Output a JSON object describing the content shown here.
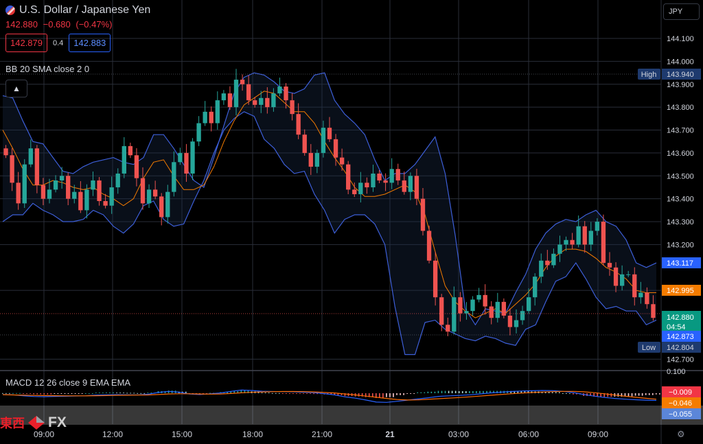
{
  "header": {
    "symbol_title": "U.S. Dollar / Japanese Yen",
    "last_price": "142.880",
    "change": "−0.680",
    "change_pct": "(−0.47%)",
    "bid": "142.879",
    "spread": "0.4",
    "ask": "142.883",
    "currency_button": "JPY"
  },
  "indicators": {
    "bb_label": "BB 20 SMA close 2 0",
    "macd_label": "MACD 12 26 close 9 EMA EMA"
  },
  "watermark": {
    "cn": "東西",
    "fx": "FX"
  },
  "colors": {
    "up": "#26a69a",
    "down": "#ef5350",
    "bb_band": "#3d5fd9",
    "bb_basis": "#f57c00",
    "macd_line": "#2962ff",
    "signal_line": "#ff6d00",
    "grid": "#2a2e39"
  },
  "icons": {
    "collapse": "chevron-up-icon",
    "settings": "gear-icon",
    "flag": "us-flag-icon"
  },
  "chart_data": [
    {
      "type": "line",
      "series_kind": "candlestick",
      "ylim": [
        142.68,
        144.15
      ],
      "y_ticks": [
        "144.100",
        "144.000",
        "143.900",
        "143.800",
        "143.700",
        "143.600",
        "143.500",
        "143.400",
        "143.300",
        "143.200",
        "143.000",
        "142.700"
      ],
      "x_ticks": [
        "09:00",
        "12:00",
        "15:00",
        "18:00",
        "21:00",
        "21",
        "03:00",
        "06:00",
        "09:00"
      ],
      "price_labels": [
        {
          "tag": "High",
          "value": "143.940",
          "kind": "high"
        },
        {
          "value": "143.117",
          "kind": "bb-upper"
        },
        {
          "value": "142.995",
          "kind": "bb-basis"
        },
        {
          "value": "142.880",
          "sub": "04:54",
          "kind": "last"
        },
        {
          "value": "142.873",
          "kind": "bb-lower"
        },
        {
          "tag": "Low",
          "value": "142.804",
          "kind": "low"
        }
      ],
      "close": [
        143.59,
        143.47,
        143.38,
        143.55,
        143.62,
        143.46,
        143.4,
        143.44,
        143.48,
        143.5,
        143.4,
        143.43,
        143.35,
        143.44,
        143.48,
        143.39,
        143.37,
        143.45,
        143.51,
        143.63,
        143.59,
        143.49,
        143.38,
        143.44,
        143.41,
        143.32,
        143.43,
        143.56,
        143.6,
        143.51,
        143.65,
        143.73,
        143.78,
        143.73,
        143.83,
        143.86,
        143.8,
        143.92,
        143.9,
        143.83,
        143.81,
        143.84,
        143.8,
        143.86,
        143.89,
        143.83,
        143.77,
        143.68,
        143.6,
        143.54,
        143.6,
        143.71,
        143.66,
        143.58,
        143.55,
        143.44,
        143.42,
        143.47,
        143.45,
        143.51,
        143.48,
        143.47,
        143.53,
        143.48,
        143.43,
        143.5,
        143.4,
        143.26,
        143.13,
        142.97,
        142.85,
        142.82,
        142.97,
        142.9,
        142.91,
        142.96,
        142.98,
        142.93,
        142.88,
        142.95,
        142.89,
        142.84,
        142.87,
        142.91,
        142.97,
        143.06,
        143.13,
        143.11,
        143.16,
        143.2,
        143.22,
        143.2,
        143.28,
        143.2,
        143.26,
        143.3,
        143.12,
        143.1,
        143.02,
        143.07,
        143.07,
        142.97,
        142.99,
        142.94,
        142.88
      ],
      "bb_upper": [
        143.85,
        143.84,
        143.74,
        143.65,
        143.64,
        143.58,
        143.52,
        143.51,
        143.54,
        143.56,
        143.57,
        143.58,
        143.56,
        143.55,
        143.58,
        143.68,
        143.68,
        143.62,
        143.55,
        143.48,
        143.45,
        143.58,
        143.72,
        143.86,
        143.93,
        143.95,
        143.94,
        143.91,
        143.87,
        143.86,
        143.88,
        143.94,
        143.95,
        143.83,
        143.77,
        143.73,
        143.68,
        143.57,
        143.48,
        143.51,
        143.51,
        143.55,
        143.61,
        143.67,
        143.51,
        143.24,
        142.92,
        142.85,
        142.92,
        142.91,
        142.9,
        142.99,
        143.07,
        143.18,
        143.25,
        143.29,
        143.31,
        143.3,
        143.33,
        143.35,
        143.3,
        143.28,
        143.22,
        143.12,
        143.1,
        143.12
      ],
      "bb_basis": [
        143.7,
        143.62,
        143.53,
        143.46,
        143.46,
        143.48,
        143.47,
        143.45,
        143.44,
        143.45,
        143.42,
        143.4,
        143.37,
        143.4,
        143.49,
        143.56,
        143.57,
        143.5,
        143.44,
        143.44,
        143.46,
        143.54,
        143.65,
        143.74,
        143.81,
        143.84,
        143.87,
        143.86,
        143.82,
        143.78,
        143.78,
        143.73,
        143.65,
        143.58,
        143.52,
        143.45,
        143.41,
        143.41,
        143.42,
        143.44,
        143.46,
        143.43,
        143.33,
        143.17,
        143.02,
        142.95,
        142.91,
        142.88,
        142.9,
        142.92,
        142.9,
        142.94,
        142.98,
        143.03,
        143.1,
        143.15,
        143.18,
        143.18,
        143.17,
        143.14,
        143.1,
        143.08,
        143.05,
        143.0,
        142.99,
        142.99
      ],
      "bb_lower": [
        143.3,
        143.33,
        143.33,
        143.38,
        143.35,
        143.33,
        143.3,
        143.3,
        143.31,
        143.35,
        143.33,
        143.28,
        143.25,
        143.29,
        143.37,
        143.39,
        143.31,
        143.28,
        143.29,
        143.39,
        143.48,
        143.6,
        143.7,
        143.75,
        143.78,
        143.76,
        143.66,
        143.62,
        143.55,
        143.51,
        143.52,
        143.42,
        143.35,
        143.25,
        143.31,
        143.33,
        143.33,
        143.29,
        143.2,
        142.93,
        142.72,
        142.72,
        142.86,
        142.87,
        142.83,
        142.81,
        142.79,
        142.78,
        142.8,
        142.79,
        142.77,
        142.76,
        142.83,
        142.85,
        142.95,
        143.04,
        143.06,
        143.12,
        143.05,
        142.97,
        142.92,
        142.93,
        142.91,
        142.91,
        142.85,
        142.87
      ],
      "title": "U.S. Dollar / Japanese Yen"
    },
    {
      "type": "line",
      "subtype": "macd",
      "ylim": [
        -0.1,
        0.1
      ],
      "y_ticks": [
        "0.100"
      ],
      "value_labels": [
        {
          "value": "−0.009",
          "kind": "histogram"
        },
        {
          "value": "−0.046",
          "kind": "signal"
        },
        {
          "value": "−0.055",
          "kind": "macd"
        }
      ],
      "macd": [
        -0.01,
        -0.012,
        -0.02,
        -0.025,
        -0.027,
        -0.024,
        -0.023,
        -0.021,
        -0.02,
        -0.014,
        -0.012,
        -0.011,
        -0.012,
        -0.013,
        -0.008,
        0.006,
        0.014,
        0.008,
        -0.006,
        -0.01,
        -0.004,
        0.002,
        0.014,
        0.024,
        0.021,
        0.015,
        0.013,
        0.012,
        0.011,
        0.008,
        0.004,
        -0.003,
        -0.013,
        -0.028,
        -0.038,
        -0.052,
        -0.068,
        -0.07,
        -0.062,
        -0.053,
        -0.044,
        -0.035,
        -0.024,
        -0.02,
        -0.017,
        -0.012,
        -0.005,
        0.002,
        0.008,
        0.013,
        0.017,
        0.019,
        0.021,
        0.02,
        0.014,
        0.005,
        -0.01,
        -0.022,
        -0.032,
        -0.04,
        -0.046,
        -0.05,
        -0.053,
        -0.055
      ],
      "signal": [
        -0.011,
        -0.013,
        -0.015,
        -0.017,
        -0.018,
        -0.019,
        -0.02,
        -0.02,
        -0.02,
        -0.019,
        -0.018,
        -0.016,
        -0.015,
        -0.014,
        -0.013,
        -0.01,
        -0.006,
        -0.004,
        -0.004,
        -0.006,
        -0.007,
        -0.006,
        -0.002,
        0.003,
        0.007,
        0.01,
        0.012,
        0.013,
        0.013,
        0.012,
        0.01,
        0.006,
        0.002,
        -0.006,
        -0.013,
        -0.022,
        -0.031,
        -0.04,
        -0.048,
        -0.052,
        -0.051,
        -0.047,
        -0.042,
        -0.038,
        -0.033,
        -0.028,
        -0.022,
        -0.016,
        -0.01,
        -0.004,
        0.001,
        0.005,
        0.009,
        0.012,
        0.014,
        0.014,
        0.011,
        0.004,
        -0.004,
        -0.014,
        -0.023,
        -0.031,
        -0.039,
        -0.046
      ]
    }
  ]
}
